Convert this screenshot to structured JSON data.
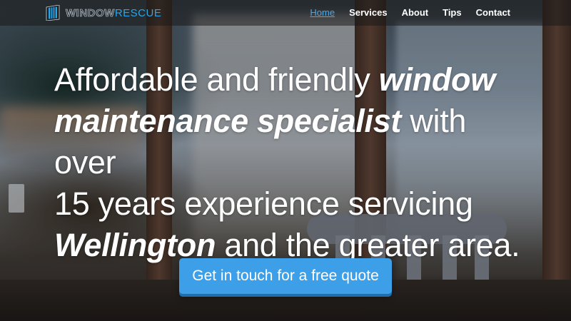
{
  "brand": {
    "logo_part1": "WINDOW",
    "logo_part2": "RESCUE",
    "accent_color": "#3d9fe8"
  },
  "nav": {
    "items": [
      {
        "label": "Home",
        "active": true
      },
      {
        "label": "Services"
      },
      {
        "label": "About"
      },
      {
        "label": "Tips"
      },
      {
        "label": "Contact"
      }
    ]
  },
  "hero": {
    "line1_a": "Affordable and friendly ",
    "line1_b": "window",
    "line2_a": "maintenance specialist",
    "line2_b": " with over",
    "line3": "15 years experience servicing",
    "line4_a": "Wellington",
    "line4_b": " and the greater area.",
    "cta_label": "Get in touch for a free quote"
  }
}
